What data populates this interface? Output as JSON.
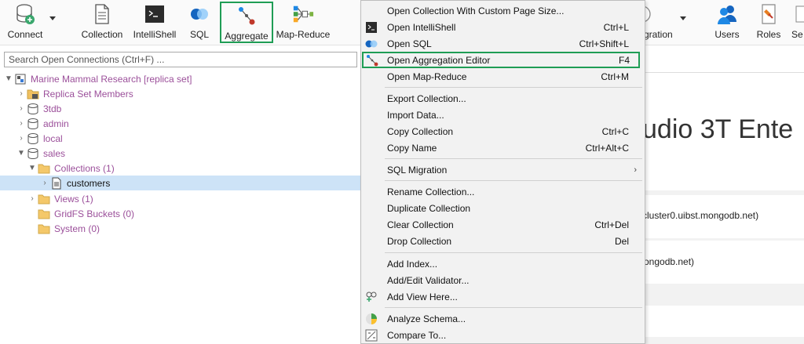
{
  "toolbar": {
    "connect": "Connect",
    "collection": "Collection",
    "intellishell": "IntelliShell",
    "sql": "SQL",
    "aggregate": "Aggregate",
    "map_reduce": "Map-Reduce",
    "migration": "gration",
    "users": "Users",
    "roles": "Roles",
    "se": "Se"
  },
  "search": {
    "placeholder": "Search Open Connections (Ctrl+F) ..."
  },
  "tree": [
    {
      "label": "Marine Mammal Research [replica set]"
    },
    {
      "label": "Replica Set Members"
    },
    {
      "label": "3tdb"
    },
    {
      "label": "admin"
    },
    {
      "label": "local"
    },
    {
      "label": "sales"
    },
    {
      "label": "Collections (1)"
    },
    {
      "label": "customers"
    },
    {
      "label": "Views (1)"
    },
    {
      "label": "GridFS Buckets (0)"
    },
    {
      "label": "System (0)"
    }
  ],
  "menu": [
    {
      "label": "Open Collection With Custom Page Size...",
      "shortcut": ""
    },
    {
      "label": "Open IntelliShell",
      "shortcut": "Ctrl+L"
    },
    {
      "label": "Open SQL",
      "shortcut": "Ctrl+Shift+L"
    },
    {
      "label": "Open Aggregation Editor",
      "shortcut": "F4"
    },
    {
      "label": "Open Map-Reduce",
      "shortcut": "Ctrl+M"
    },
    {
      "label": "Export Collection...",
      "shortcut": ""
    },
    {
      "label": "Import Data...",
      "shortcut": ""
    },
    {
      "label": "Copy Collection",
      "shortcut": "Ctrl+C"
    },
    {
      "label": "Copy Name",
      "shortcut": "Ctrl+Alt+C"
    },
    {
      "label": "SQL Migration",
      "shortcut": ""
    },
    {
      "label": "Rename Collection...",
      "shortcut": ""
    },
    {
      "label": "Duplicate Collection",
      "shortcut": ""
    },
    {
      "label": "Clear Collection",
      "shortcut": "Ctrl+Del"
    },
    {
      "label": "Drop Collection",
      "shortcut": "Del"
    },
    {
      "label": "Add Index...",
      "shortcut": ""
    },
    {
      "label": "Add/Edit Validator...",
      "shortcut": ""
    },
    {
      "label": "Add View Here...",
      "shortcut": ""
    },
    {
      "label": "Analyze Schema...",
      "shortcut": ""
    },
    {
      "label": "Compare To...",
      "shortcut": ""
    }
  ],
  "submenu_arrow": "›",
  "right": {
    "title": "udio 3T Ente",
    "host1": "cluster0.uibst.mongodb.net)",
    "host2": "ongodb.net)"
  },
  "colors": {
    "accent_green": "#1f9d55",
    "tree_purple": "#9b4f9a",
    "selected_row": "#cde3f7"
  },
  "icons": {
    "connect": "database-plug-icon",
    "collection": "document-icon",
    "intellishell": "terminal-icon",
    "sql": "sql-circles-icon",
    "aggregate": "pipeline-icon",
    "map_reduce": "map-reduce-icon",
    "users": "users-icon",
    "roles": "roles-icon"
  }
}
